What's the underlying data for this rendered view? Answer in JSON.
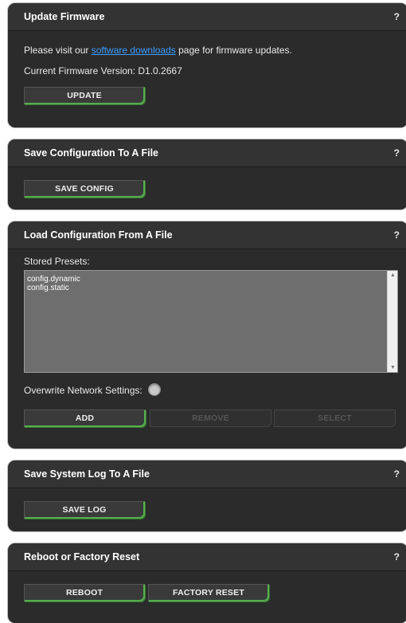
{
  "firmware": {
    "title": "Update Firmware",
    "help": "?",
    "visit_prefix": "Please visit our ",
    "visit_link": "software downloads",
    "visit_suffix": " page for firmware updates.",
    "version_label": "Current Firmware Version: ",
    "version_value": "D1.0.2667",
    "update_button": "UPDATE"
  },
  "save_config": {
    "title": "Save Configuration To A File",
    "help": "?",
    "button": "SAVE CONFIG"
  },
  "load_config": {
    "title": "Load Configuration From A File",
    "help": "?",
    "presets_label": "Stored Presets:",
    "presets": [
      "config.dynamic",
      "config.static"
    ],
    "overwrite_label": "Overwrite Network Settings:",
    "overwrite_enabled": false,
    "add_button": "ADD",
    "remove_button": "REMOVE",
    "select_button": "SELECT"
  },
  "save_log": {
    "title": "Save System Log To A File",
    "help": "?",
    "button": "SAVE LOG"
  },
  "reboot": {
    "title": "Reboot or Factory Reset",
    "help": "?",
    "reboot_button": "REBOOT",
    "factory_reset_button": "FACTORY RESET"
  },
  "colors": {
    "panel_bg": "#2b2b2b",
    "header_bg": "#333333",
    "button_accent": "#4caf50",
    "link": "#3a9dff"
  }
}
